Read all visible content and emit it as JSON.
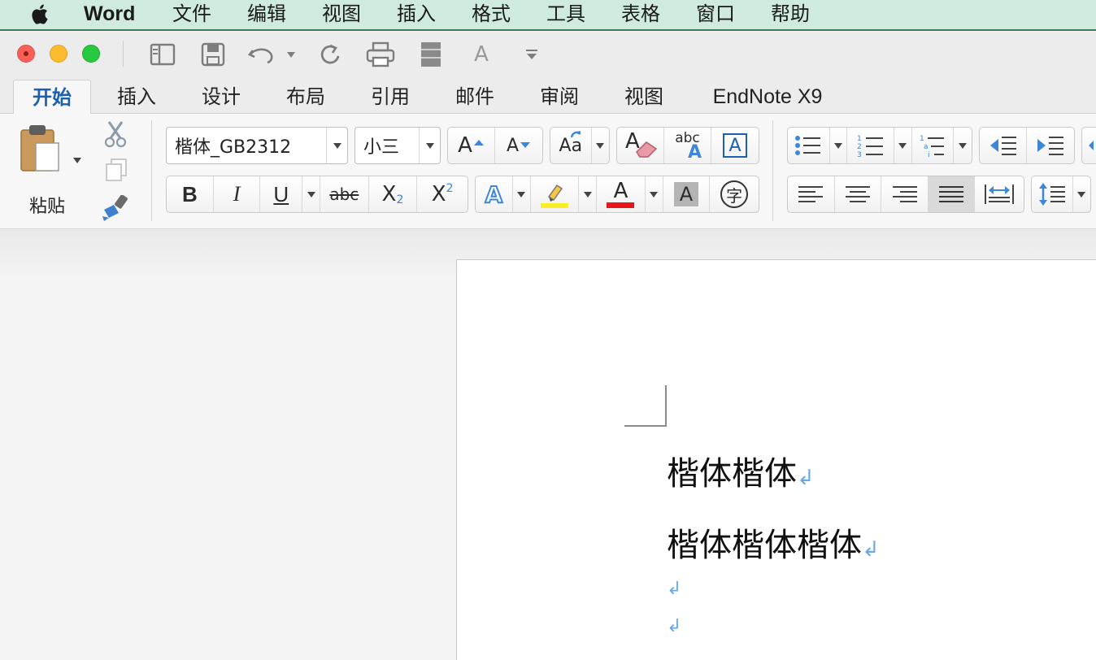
{
  "menubar": {
    "app_name": "Word",
    "items": [
      "文件",
      "编辑",
      "视图",
      "插入",
      "格式",
      "工具",
      "表格",
      "窗口",
      "帮助"
    ]
  },
  "window": {
    "controls": [
      "close",
      "minimize",
      "zoom"
    ],
    "quick_access_icons": [
      "sidebar-icon",
      "save-icon",
      "undo-icon",
      "redo-icon",
      "print-icon",
      "document-icon",
      "text-icon",
      "customize-icon"
    ]
  },
  "ribbon_tabs": [
    {
      "label": "开始",
      "active": true
    },
    {
      "label": "插入"
    },
    {
      "label": "设计"
    },
    {
      "label": "布局"
    },
    {
      "label": "引用"
    },
    {
      "label": "邮件"
    },
    {
      "label": "审阅"
    },
    {
      "label": "视图"
    },
    {
      "label": "EndNote X9"
    }
  ],
  "ribbon": {
    "paste_label": "粘贴",
    "font_name": "楷体_GB2312",
    "font_size": "小三",
    "bold": "B",
    "italic": "I",
    "underline": "U",
    "strike": "abc",
    "subscript": "X",
    "subscript_mark": "2",
    "superscript": "X",
    "superscript_mark": "2",
    "grow": "A",
    "shrink": "A",
    "change_case": "Aa",
    "clear": "A",
    "spell": "abc",
    "spell_a": "A",
    "border_a": "A",
    "effect_a": "A",
    "color_a": "A",
    "shade_a": "A",
    "phonetic": "字",
    "highlight_color": "#f7ef2a",
    "font_color": "#e8161a",
    "accent": "#1c5fb0"
  },
  "document": {
    "lines": [
      "楷体楷体",
      "楷体楷体楷体",
      "",
      ""
    ],
    "paragraph_mark": "↲"
  }
}
